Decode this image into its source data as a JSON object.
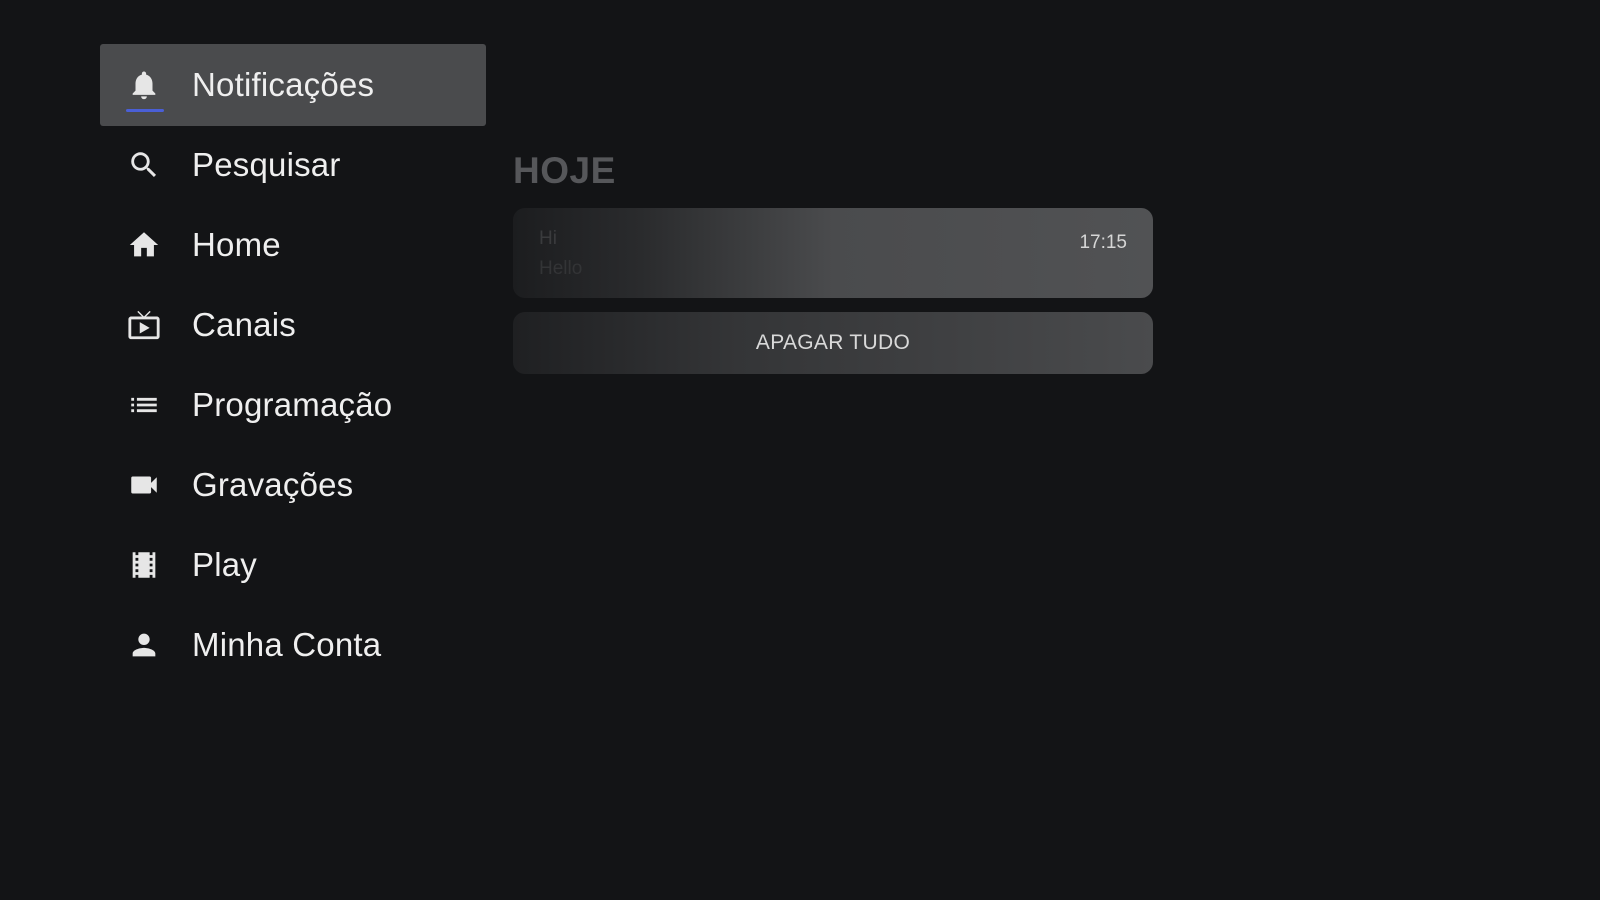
{
  "sidebar": {
    "items": [
      {
        "label": "Notificações",
        "icon": "bell-icon",
        "active": true
      },
      {
        "label": "Pesquisar",
        "icon": "search-icon",
        "active": false
      },
      {
        "label": "Home",
        "icon": "home-icon",
        "active": false
      },
      {
        "label": "Canais",
        "icon": "tv-icon",
        "active": false
      },
      {
        "label": "Programação",
        "icon": "list-icon",
        "active": false
      },
      {
        "label": "Gravações",
        "icon": "videocam-icon",
        "active": false
      },
      {
        "label": "Play",
        "icon": "film-icon",
        "active": false
      },
      {
        "label": "Minha Conta",
        "icon": "person-icon",
        "active": false
      }
    ]
  },
  "notifications": {
    "section_title": "HOJE",
    "items": [
      {
        "title": "Hi",
        "body": "Hello",
        "time": "17:15"
      }
    ],
    "clear_all_label": "APAGAR TUDO"
  },
  "colors": {
    "background": "#131416",
    "active_item": "#4a4b4d",
    "accent_underline": "#4a5fd6"
  }
}
